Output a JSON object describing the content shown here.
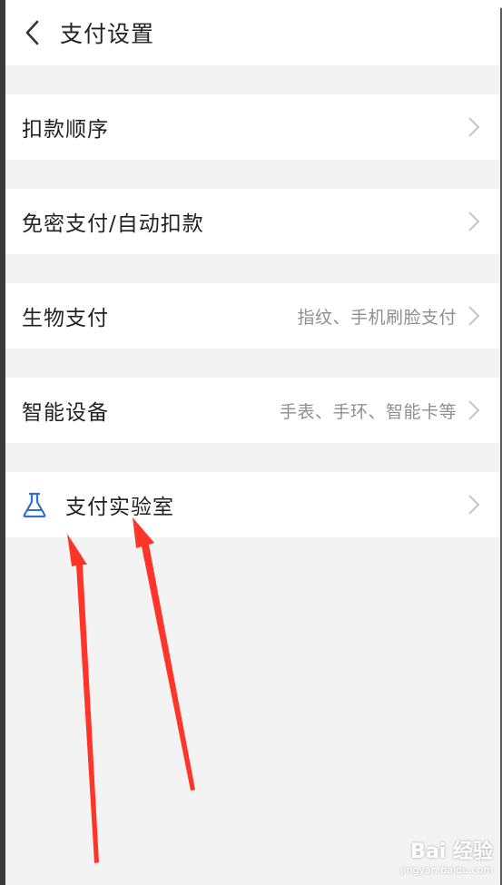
{
  "header": {
    "back_icon": "chevron-left-icon",
    "title": "支付设置"
  },
  "rows": [
    {
      "label": "扣款顺序",
      "value": ""
    },
    {
      "label": "免密支付/自动扣款",
      "value": ""
    },
    {
      "label": "生物支付",
      "value": "指纹、手机刷脸支付"
    },
    {
      "label": "智能设备",
      "value": "手表、手环、智能卡等"
    },
    {
      "label": "支付实验室",
      "value": "",
      "icon": "flask-icon"
    }
  ],
  "colors": {
    "accent": "#2f6fd0",
    "annotation_arrow": "#ff2a1f",
    "background": "#f3f3f3"
  },
  "watermark": {
    "main": "Bai 经验",
    "sub": "jingyan.baidu.com"
  }
}
